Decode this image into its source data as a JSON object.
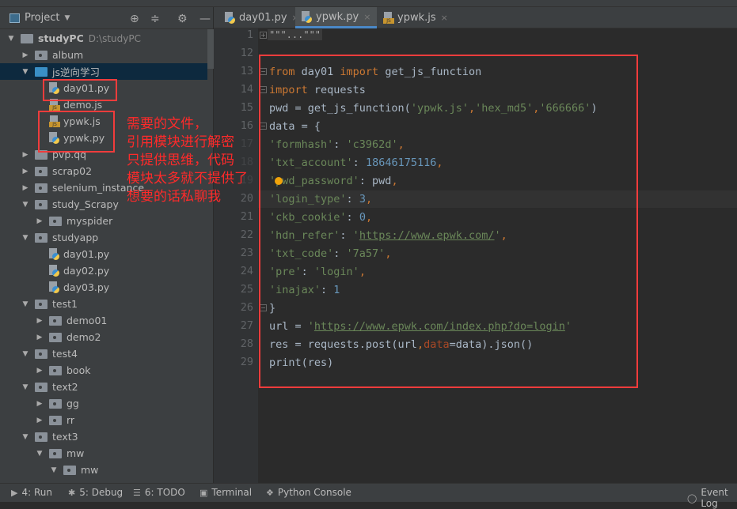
{
  "project_panel": {
    "title": "Project",
    "icons": [
      "locate-icon",
      "collapse-all-icon",
      "gear-icon",
      "minimize-icon"
    ]
  },
  "tree": [
    {
      "label": "studyPC",
      "path": "D:\\studyPC",
      "type": "root",
      "depth": 0,
      "open": true
    },
    {
      "label": "album",
      "type": "folder",
      "depth": 1,
      "open": false
    },
    {
      "label": "js逆向学习",
      "type": "folder-blue",
      "depth": 1,
      "open": true,
      "selected": true
    },
    {
      "label": "day01.py",
      "type": "py",
      "depth": 2
    },
    {
      "label": "demo.js",
      "type": "js",
      "depth": 2
    },
    {
      "label": "ypwk.js",
      "type": "js",
      "depth": 2
    },
    {
      "label": "ypwk.py",
      "type": "py",
      "depth": 2
    },
    {
      "label": "pvp.qq",
      "type": "folder-plain",
      "depth": 1,
      "open": false
    },
    {
      "label": "scrap02",
      "type": "folder",
      "depth": 1,
      "open": false
    },
    {
      "label": "selenium_instance",
      "type": "folder",
      "depth": 1,
      "open": false
    },
    {
      "label": "study_Scrapy",
      "type": "folder",
      "depth": 1,
      "open": true
    },
    {
      "label": "myspider",
      "type": "folder",
      "depth": 2,
      "open": false
    },
    {
      "label": "studyapp",
      "type": "folder",
      "depth": 1,
      "open": true
    },
    {
      "label": "day01.py",
      "type": "py",
      "depth": 2
    },
    {
      "label": "day02.py",
      "type": "py",
      "depth": 2
    },
    {
      "label": "day03.py",
      "type": "py",
      "depth": 2
    },
    {
      "label": "test1",
      "type": "folder",
      "depth": 1,
      "open": true
    },
    {
      "label": "demo01",
      "type": "folder",
      "depth": 2,
      "open": false
    },
    {
      "label": "demo2",
      "type": "folder",
      "depth": 2,
      "open": false
    },
    {
      "label": "test4",
      "type": "folder",
      "depth": 1,
      "open": true
    },
    {
      "label": "book",
      "type": "folder",
      "depth": 2,
      "open": false
    },
    {
      "label": "text2",
      "type": "folder",
      "depth": 1,
      "open": true
    },
    {
      "label": "gg",
      "type": "folder",
      "depth": 2,
      "open": false
    },
    {
      "label": "rr",
      "type": "folder",
      "depth": 2,
      "open": false
    },
    {
      "label": "text3",
      "type": "folder",
      "depth": 1,
      "open": true
    },
    {
      "label": "mw",
      "type": "folder",
      "depth": 2,
      "open": true
    },
    {
      "label": "mw",
      "type": "folder",
      "depth": 3,
      "open": true
    }
  ],
  "tabs": [
    {
      "label": "day01.py",
      "icon": "python-file-icon"
    },
    {
      "label": "ypwk.py",
      "icon": "python-file-icon",
      "active": true
    },
    {
      "label": "ypwk.js",
      "icon": "js-file-icon"
    }
  ],
  "editor": {
    "collapsed_docstring": "\"\"\"...\"\"\"",
    "current_line": "20",
    "lines": [
      {
        "num": "1",
        "tokens": []
      },
      {
        "num": "12",
        "tokens": []
      },
      {
        "num": "13",
        "tokens": [
          [
            "from ",
            "k"
          ],
          [
            "day01 ",
            "t"
          ],
          [
            "import ",
            "k"
          ],
          [
            "get_js_function",
            "t"
          ]
        ]
      },
      {
        "num": "14",
        "tokens": [
          [
            "import ",
            "k"
          ],
          [
            "requests",
            "t"
          ]
        ]
      },
      {
        "num": "15",
        "tokens": [
          [
            "pwd = get_js_function(",
            "t"
          ],
          [
            "'ypwk.js'",
            "s"
          ],
          [
            ",",
            "k"
          ],
          [
            "'hex_md5'",
            "s"
          ],
          [
            ",",
            "k"
          ],
          [
            "'666666'",
            "s"
          ],
          [
            ")",
            "t"
          ]
        ]
      },
      {
        "num": "16",
        "tokens": [
          [
            "data = {",
            "t"
          ]
        ]
      },
      {
        "num": "17",
        "tokens": [
          [
            "'formhash'",
            "s"
          ],
          [
            ": ",
            "t"
          ],
          [
            "'c3962d'",
            "s"
          ],
          [
            ",",
            "k"
          ]
        ]
      },
      {
        "num": "18",
        "tokens": [
          [
            "'txt_account'",
            "s"
          ],
          [
            ": ",
            "t"
          ],
          [
            "18646175116",
            "n"
          ],
          [
            ",",
            "k"
          ]
        ]
      },
      {
        "num": "19",
        "tokens": [
          [
            "'pwd_password'",
            "s"
          ],
          [
            ": pwd",
            "t"
          ],
          [
            ",",
            "k"
          ]
        ]
      },
      {
        "num": "20",
        "tokens": [
          [
            "'login_type'",
            "s"
          ],
          [
            ": ",
            "t"
          ],
          [
            "3",
            "n"
          ],
          [
            ",",
            "k"
          ]
        ]
      },
      {
        "num": "21",
        "tokens": [
          [
            "'ckb_cookie'",
            "s"
          ],
          [
            ": ",
            "t"
          ],
          [
            "0",
            "n"
          ],
          [
            ",",
            "k"
          ]
        ]
      },
      {
        "num": "22",
        "tokens": [
          [
            "'hdn_refer'",
            "s"
          ],
          [
            ": ",
            "t"
          ],
          [
            "'",
            "s"
          ],
          [
            "https://www.epwk.com/",
            "s u"
          ],
          [
            "'",
            "s"
          ],
          [
            ",",
            "k"
          ]
        ]
      },
      {
        "num": "23",
        "tokens": [
          [
            "'txt_code'",
            "s"
          ],
          [
            ": ",
            "t"
          ],
          [
            "'7a57'",
            "s"
          ],
          [
            ",",
            "k"
          ]
        ]
      },
      {
        "num": "24",
        "tokens": [
          [
            "'pre'",
            "s"
          ],
          [
            ": ",
            "t"
          ],
          [
            "'login'",
            "s"
          ],
          [
            ",",
            "k"
          ]
        ]
      },
      {
        "num": "25",
        "tokens": [
          [
            "'inajax'",
            "s"
          ],
          [
            ": ",
            "t"
          ],
          [
            "1",
            "n"
          ]
        ]
      },
      {
        "num": "26",
        "tokens": [
          [
            "}",
            "t"
          ]
        ]
      },
      {
        "num": "27",
        "tokens": [
          [
            "url = ",
            "t"
          ],
          [
            "'",
            "s"
          ],
          [
            "https://www.epwk.com/index.php?do=login",
            "s u"
          ],
          [
            "'",
            "s"
          ]
        ]
      },
      {
        "num": "28",
        "tokens": [
          [
            "res = requests.post(url",
            "t"
          ],
          [
            ",",
            "k"
          ],
          [
            "data",
            "a"
          ],
          [
            "=data).json()",
            "t"
          ]
        ]
      },
      {
        "num": "29",
        "tokens": [
          [
            "print(res)",
            "t"
          ]
        ]
      }
    ]
  },
  "annotation": "需要的文件，\n引用模块进行解密\n只提供思维，代码\n模块太多就不提供了\n想要的话私聊我",
  "annotation_color": "#ff2a2a",
  "bottom_bar": [
    {
      "label": "4: Run",
      "icon": "run-icon"
    },
    {
      "label": "5: Debug",
      "icon": "bug-icon"
    },
    {
      "label": "6: TODO",
      "icon": "list-icon"
    },
    {
      "label": "Terminal",
      "icon": "terminal-icon"
    },
    {
      "label": "Python Console",
      "icon": "python-icon"
    },
    {
      "label": "Event Log",
      "icon": "event-log-icon"
    }
  ]
}
